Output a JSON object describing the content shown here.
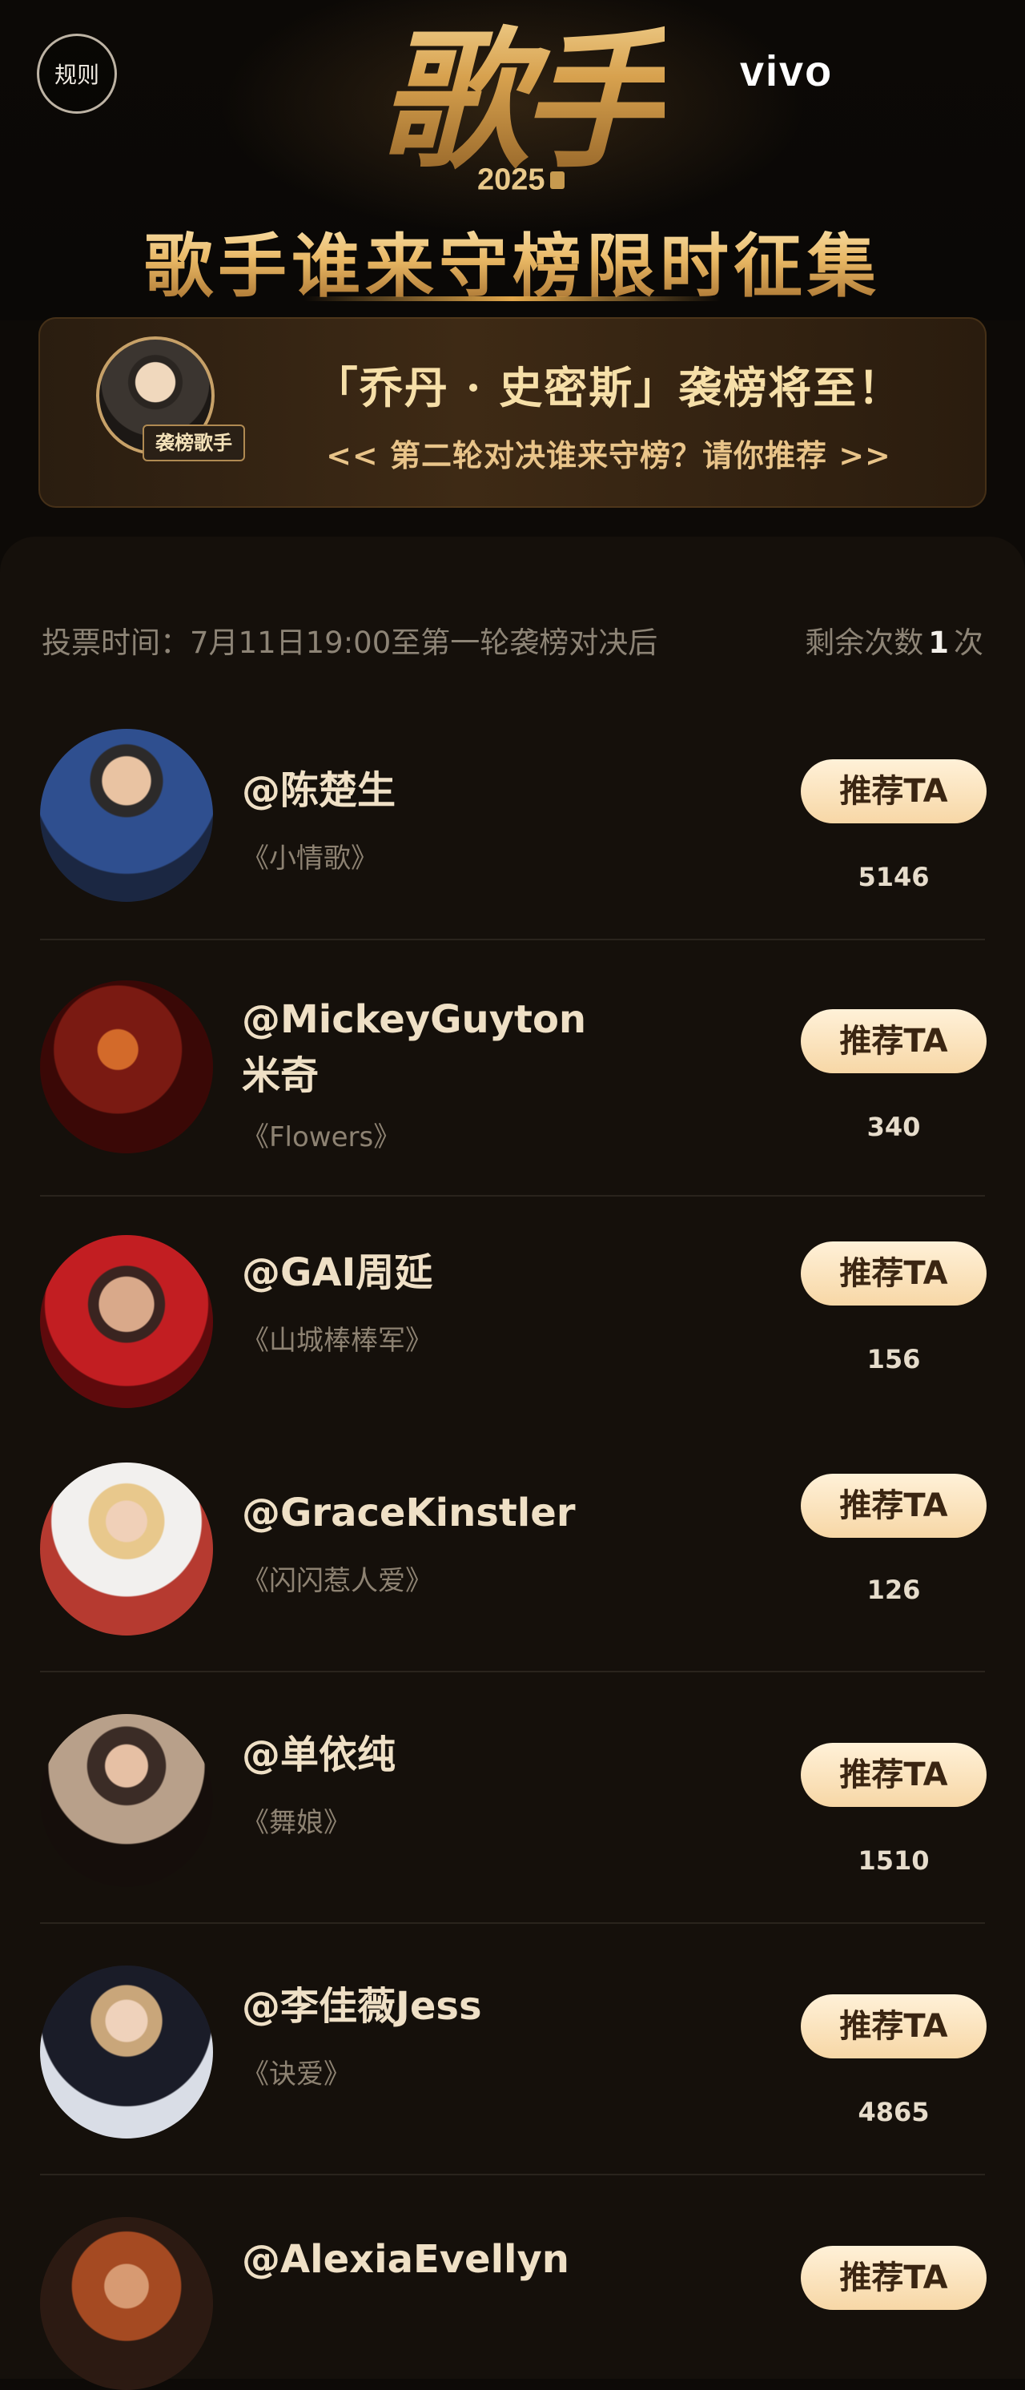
{
  "header": {
    "rules_label": "规则",
    "logo_text": "歌手",
    "logo_year": "2025",
    "brand": "vivo",
    "headline": "歌手谁来守榜限时征集"
  },
  "banner": {
    "tag": "袭榜歌手",
    "line1": "「乔丹 · 史密斯」袭榜将至！",
    "line2": "<< 第二轮对决谁来守榜？请你推荐 >>"
  },
  "vote": {
    "time_text": "投票时间：7月11日19:00至第一轮袭榜对决后",
    "remain_prefix": "剩余次数",
    "remain_count": "1",
    "remain_suffix": "次"
  },
  "candidates": [
    {
      "name": "@陈楚生",
      "song": "《小情歌》",
      "button": "推荐TA",
      "votes": "5146"
    },
    {
      "name": "@MickeyGuyton米奇",
      "song": "《Flowers》",
      "button": "推荐TA",
      "votes": "340"
    },
    {
      "name": "@GAI周延",
      "song": "《山城棒棒军》",
      "button": "推荐TA",
      "votes": "156"
    },
    {
      "name": "@GraceKinstler",
      "song": "《闪闪惹人爱》",
      "button": "推荐TA",
      "votes": "126"
    },
    {
      "name": "@单依纯",
      "song": "《舞娘》",
      "button": "推荐TA",
      "votes": "1510"
    },
    {
      "name": "@李佳薇Jess",
      "song": "《诀爱》",
      "button": "推荐TA",
      "votes": "4865"
    },
    {
      "name": "@AlexiaEvellyn",
      "song": "",
      "button": "推荐TA",
      "votes": ""
    }
  ],
  "colors": {
    "background": "#0d0a07",
    "panel": "#15100b",
    "gold": "#e2b76a",
    "button": "#f7d7a6",
    "name": "#efe0c6",
    "muted": "#8d8476"
  }
}
